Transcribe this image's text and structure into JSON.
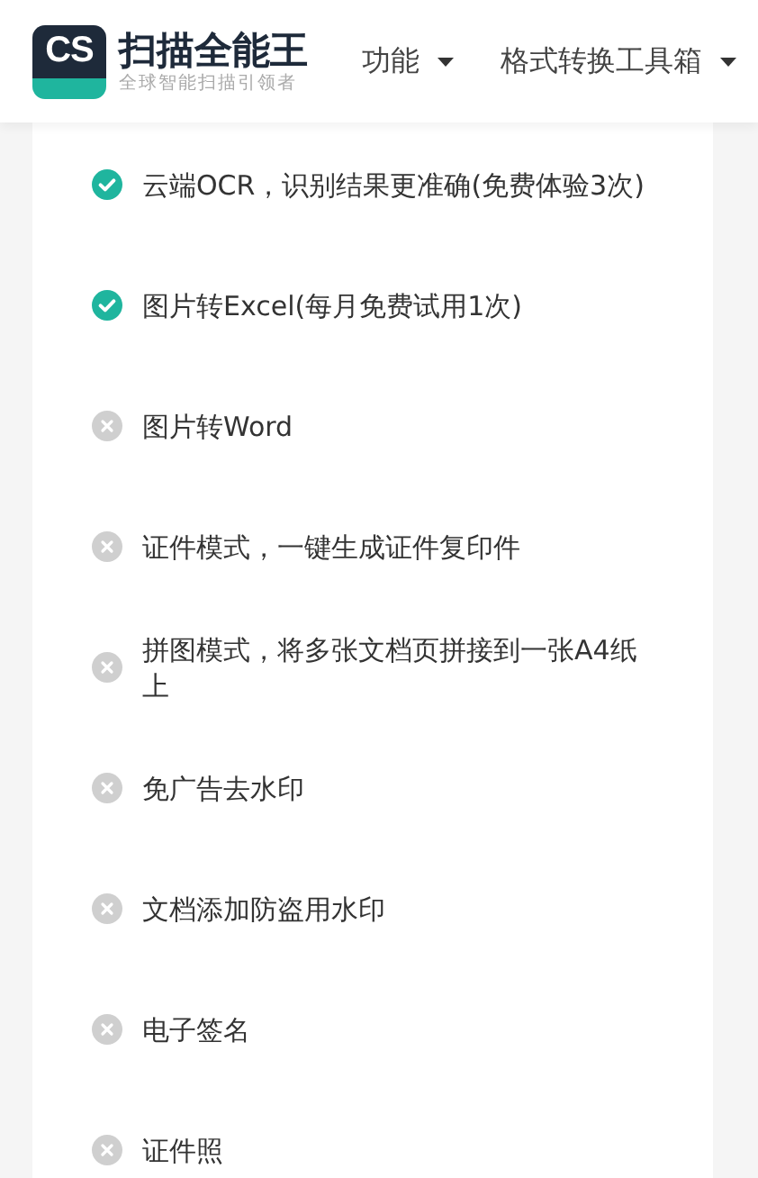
{
  "header": {
    "logo": {
      "mark": "CS",
      "title": "扫描全能王",
      "tagline": "全球智能扫描引领者"
    },
    "nav": [
      {
        "label": "功能"
      },
      {
        "label": "格式转换工具箱"
      }
    ]
  },
  "features": [
    {
      "text": "云端OCR，识别结果更准确(免费体验3次)",
      "included": true
    },
    {
      "text": "图片转Excel(每月免费试用1次)",
      "included": true
    },
    {
      "text": "图片转Word",
      "included": false
    },
    {
      "text": "证件模式，一键生成证件复印件",
      "included": false
    },
    {
      "text": "拼图模式，将多张文档页拼接到一张A4纸上",
      "included": false
    },
    {
      "text": "免广告去水印",
      "included": false
    },
    {
      "text": "文档添加防盗用水印",
      "included": false
    },
    {
      "text": "电子签名",
      "included": false
    },
    {
      "text": "证件照",
      "included": false
    }
  ]
}
